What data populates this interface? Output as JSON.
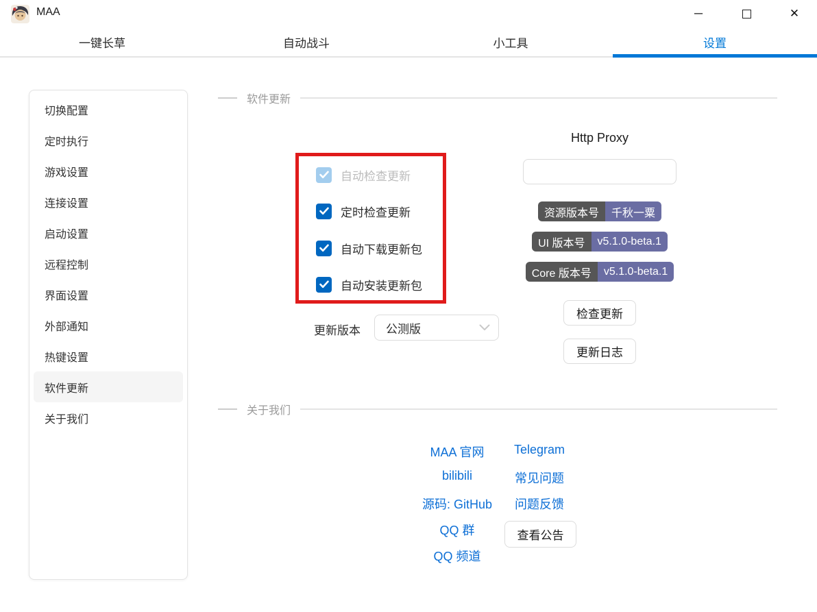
{
  "window": {
    "title": "MAA",
    "icons": {
      "minimize": "─",
      "close": "✕"
    }
  },
  "tabs": [
    {
      "label": "一键长草",
      "active": false
    },
    {
      "label": "自动战斗",
      "active": false
    },
    {
      "label": "小工具",
      "active": false
    },
    {
      "label": "设置",
      "active": true
    }
  ],
  "sidebar": {
    "items": [
      {
        "label": "切换配置",
        "selected": false
      },
      {
        "label": "定时执行",
        "selected": false
      },
      {
        "label": "游戏设置",
        "selected": false
      },
      {
        "label": "连接设置",
        "selected": false
      },
      {
        "label": "启动设置",
        "selected": false
      },
      {
        "label": "远程控制",
        "selected": false
      },
      {
        "label": "界面设置",
        "selected": false
      },
      {
        "label": "外部通知",
        "selected": false
      },
      {
        "label": "热键设置",
        "selected": false
      },
      {
        "label": "软件更新",
        "selected": true
      },
      {
        "label": "关于我们",
        "selected": false
      }
    ]
  },
  "update_section": {
    "title": "软件更新",
    "checkboxes": [
      {
        "label": "自动检查更新",
        "checked": true,
        "disabled": true
      },
      {
        "label": "定时检查更新",
        "checked": true,
        "disabled": false
      },
      {
        "label": "自动下载更新包",
        "checked": true,
        "disabled": false
      },
      {
        "label": "自动安装更新包",
        "checked": true,
        "disabled": false
      }
    ],
    "update_channel": {
      "label": "更新版本",
      "value": "公测版"
    },
    "http_proxy": {
      "label": "Http Proxy",
      "value": "",
      "placeholder": ""
    },
    "badges": [
      {
        "key": "资源版本号",
        "value": "千秋一粟"
      },
      {
        "key": "UI 版本号",
        "value": "v5.1.0-beta.1"
      },
      {
        "key": "Core 版本号",
        "value": "v5.1.0-beta.1"
      }
    ],
    "buttons": {
      "check_update": "检查更新",
      "changelog": "更新日志"
    }
  },
  "about_section": {
    "title": "关于我们",
    "links_left": [
      "MAA 官网",
      "bilibili",
      "源码: GitHub",
      "QQ 群",
      "QQ 频道"
    ],
    "links_right": [
      "Telegram",
      "常见问题",
      "问题反馈"
    ],
    "announcement_button": "查看公告"
  },
  "colors": {
    "accent": "#0078d7",
    "link": "#0d6fd6",
    "checkbox_checked": "#0067c0",
    "checkbox_disabled": "#a3cdee",
    "badge_key_bg": "#565656",
    "badge_value_bg": "#6a6da3",
    "annotation_red": "#e01b1b",
    "sidebar_selected_bg": "#f5f5f5"
  }
}
